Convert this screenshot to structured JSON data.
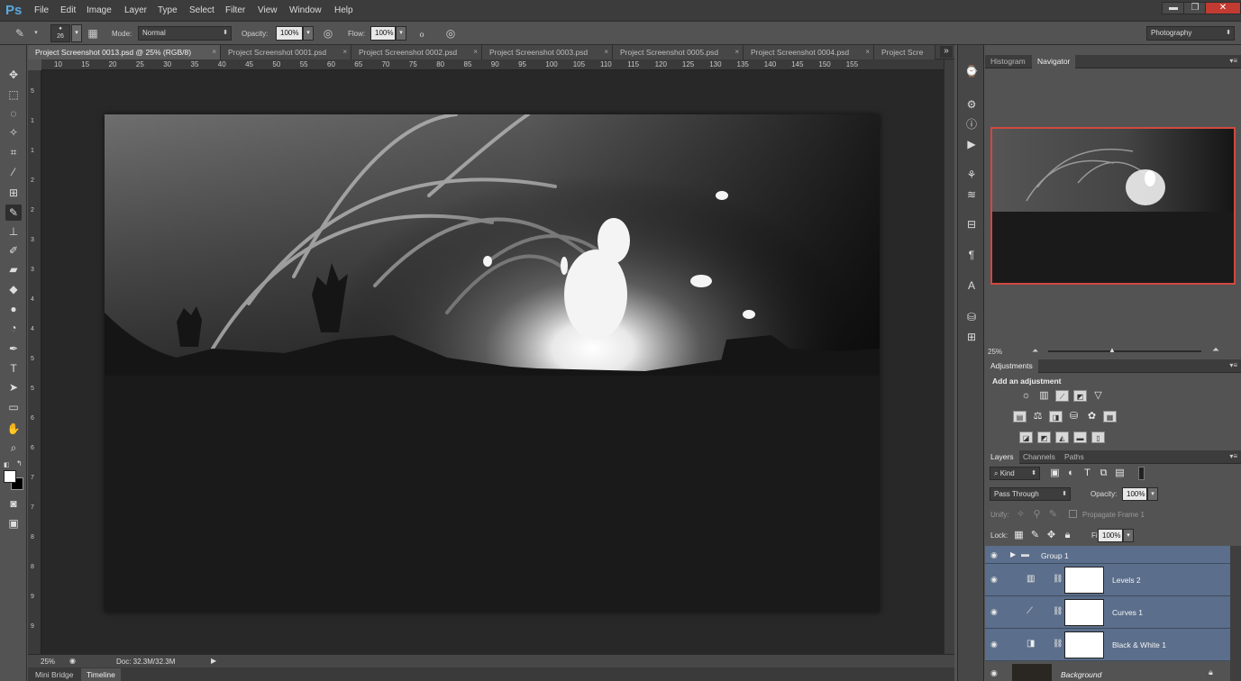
{
  "app": {
    "logo": "Ps"
  },
  "menu": [
    "File",
    "Edit",
    "Image",
    "Layer",
    "Type",
    "Select",
    "Filter",
    "View",
    "Window",
    "Help"
  ],
  "window_controls": {
    "minimize": "▬",
    "restore": "❐",
    "close": "✕"
  },
  "options_bar": {
    "brush_size": "26",
    "mode_label": "Mode:",
    "mode_value": "Normal",
    "opacity_label": "Opacity:",
    "opacity_value": "100%",
    "flow_label": "Flow:",
    "flow_value": "100%",
    "workspace": "Photography"
  },
  "doc_tabs": [
    {
      "label": "Project Screenshot 0013.psd @ 25% (RGB/8)",
      "active": true
    },
    {
      "label": "Project Screenshot 0001.psd"
    },
    {
      "label": "Project Screenshot 0002.psd"
    },
    {
      "label": "Project Screenshot 0003.psd"
    },
    {
      "label": "Project Screenshot 0005.psd"
    },
    {
      "label": "Project Screenshot 0004.psd"
    },
    {
      "label": "Project Scre"
    }
  ],
  "tab_close": "×",
  "tab_overflow": "»",
  "ruler_top": [
    "10",
    "15",
    "20",
    "25",
    "30",
    "35",
    "40",
    "45",
    "50",
    "55",
    "60",
    "65",
    "70",
    "75",
    "80",
    "85",
    "90",
    "95",
    "100",
    "105",
    "110",
    "115",
    "120",
    "125",
    "130",
    "135",
    "140",
    "145",
    "150",
    "155"
  ],
  "ruler_left": [
    "5",
    "1",
    "1",
    "2",
    "2",
    "3",
    "3",
    "4",
    "4",
    "5",
    "5",
    "6",
    "6",
    "7",
    "7",
    "8",
    "8",
    "9",
    "9"
  ],
  "status": {
    "zoom": "25%",
    "doc": "Doc: 32.3M/32.3M",
    "arrow": "▶"
  },
  "bottom_tabs": [
    "Mini Bridge",
    "Timeline"
  ],
  "navigator": {
    "tabs": [
      "Histogram",
      "Navigator"
    ],
    "zoom": "25%"
  },
  "adjustments": {
    "tab": "Adjustments",
    "heading": "Add an adjustment"
  },
  "layers": {
    "tabs": [
      "Layers",
      "Channels",
      "Paths"
    ],
    "filter_kind": "Kind",
    "blend_mode": "Pass Through",
    "opacity_label": "Opacity:",
    "opacity_value": "100%",
    "unify_label": "Unify:",
    "propagate_label": "Propagate Frame 1",
    "lock_label": "Lock:",
    "fill_label": "Fill:",
    "fill_value": "100%",
    "items": [
      {
        "name": "Group 1",
        "type": "group"
      },
      {
        "name": "Levels 2",
        "type": "adjustment"
      },
      {
        "name": "Curves 1",
        "type": "adjustment"
      },
      {
        "name": "Black & White 1",
        "type": "adjustment"
      },
      {
        "name": "Background",
        "type": "image"
      }
    ]
  },
  "colors": {
    "accent_nav_box": "#d2483f",
    "layer_selected": "#5b6e8b",
    "ps_blue": "#5aa8e0"
  }
}
